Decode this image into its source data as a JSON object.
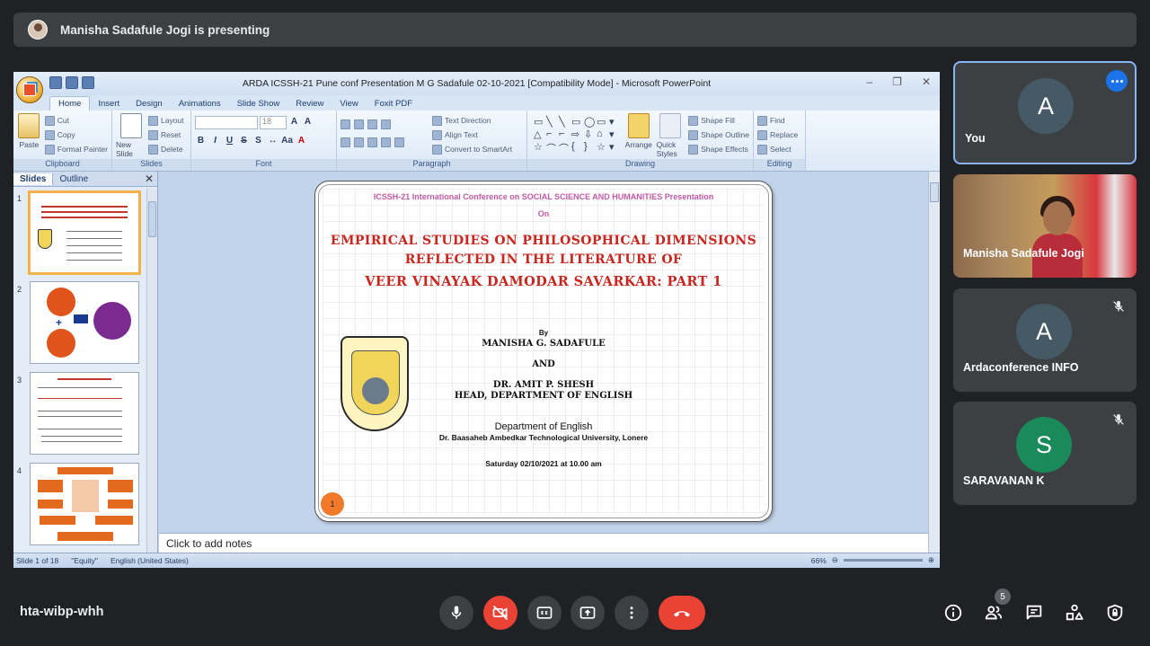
{
  "presenting": {
    "text": "Manisha Sadafule Jogi is presenting"
  },
  "ppt": {
    "window_title": "ARDA ICSSH-21 Pune  conf Presentation M G Sadafule 02-10-2021 [Compatibility Mode] - Microsoft PowerPoint",
    "tabs": [
      "Home",
      "Insert",
      "Design",
      "Animations",
      "Slide Show",
      "Review",
      "View",
      "Foxit PDF"
    ],
    "ribbon": {
      "clipboard": {
        "label": "Clipboard",
        "paste": "Paste",
        "cut": "Cut",
        "copy": "Copy",
        "format_painter": "Format Painter"
      },
      "slides": {
        "label": "Slides",
        "new_slide": "New Slide",
        "layout": "Layout",
        "reset": "Reset",
        "delete": "Delete"
      },
      "font": {
        "label": "Font",
        "size": "18"
      },
      "paragraph": {
        "label": "Paragraph",
        "text_direction": "Text Direction",
        "align_text": "Align Text",
        "smartart": "Convert to SmartArt"
      },
      "drawing": {
        "label": "Drawing",
        "arrange": "Arrange",
        "quick_styles": "Quick Styles",
        "shape_fill": "Shape Fill",
        "shape_outline": "Shape Outline",
        "shape_effects": "Shape Effects"
      },
      "editing": {
        "label": "Editing",
        "find": "Find",
        "replace": "Replace",
        "select": "Select"
      }
    },
    "pane": {
      "slides_tab": "Slides",
      "outline_tab": "Outline",
      "thumb_numbers": [
        "1",
        "2",
        "3",
        "4"
      ]
    },
    "slide": {
      "conf_line": "ICSSH-21 International Conference on  SOCIAL SCIENCE AND HUMANITIES  Presentation",
      "on": "On",
      "title1": "EMPIRICAL STUDIES ON PHILOSOPHICAL DIMENSIONS",
      "title2": "REFLECTED  IN THE  LITERATURE  OF",
      "title3": "VEER VINAYAK DAMODAR SAVARKAR: PART 1",
      "by": "By",
      "author1": "MANISHA G. SADAFULE",
      "and": "AND",
      "author2": "DR. AMIT P. SHESH",
      "author2_role": "HEAD, DEPARTMENT OF ENGLISH",
      "dept": "Department  of  English",
      "university": "Dr. Baasaheb  Ambedkar  Technological  University,  Lonere",
      "date": "Saturday  02/10/2021  at  10.00  am",
      "number": "1"
    },
    "notes_placeholder": "Click to add notes",
    "status": {
      "slide_count": "Slide 1 of 18",
      "theme": "\"Equity\"",
      "language": "English (United States)",
      "zoom": "66%"
    }
  },
  "participants": [
    {
      "initial": "A",
      "name": "You",
      "color": "#455a64"
    },
    {
      "name": "Manisha Sadafule Jogi"
    },
    {
      "initial": "A",
      "name": "Ardaconference INFO",
      "color": "#455a64"
    },
    {
      "initial": "S",
      "name": "SARAVANAN K",
      "color": "#1b8a5a"
    }
  ],
  "bottom": {
    "meeting_code": "hta-wibp-whh",
    "people_count": "5"
  },
  "colors": {
    "accent": "#1a73e8",
    "danger": "#ea4335",
    "surface": "#3c4043",
    "background": "#202124"
  }
}
